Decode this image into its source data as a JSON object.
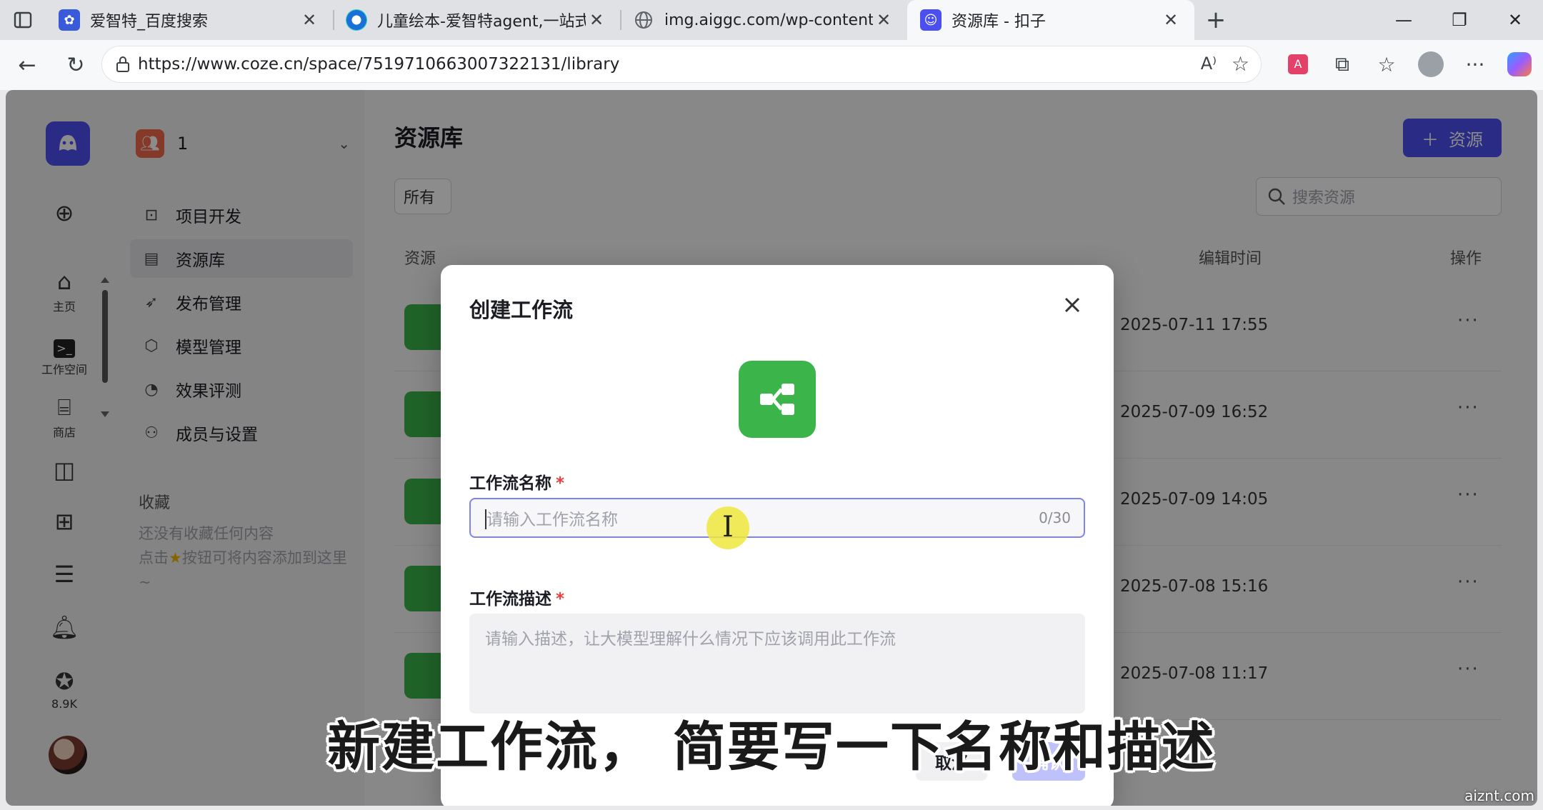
{
  "browser": {
    "tabs": [
      {
        "title": "爱智特_百度搜索",
        "icon": "baidu-paw-icon",
        "color": "#3a5bd9"
      },
      {
        "title": "儿童绘本-爱智特agent,一站式企业",
        "icon": "edge-swirl-icon",
        "color": "#1b6fd8"
      },
      {
        "title": "img.aiggc.com/wp-content/uploa",
        "icon": "globe-icon",
        "color": "#5f6368"
      },
      {
        "title": "资源库 - 扣子",
        "icon": "coze-icon",
        "color": "#4b4ff0"
      }
    ],
    "url": "https://www.coze.cn/space/7519710663007322131/library"
  },
  "rail": {
    "items": [
      {
        "label": "主页",
        "icon": "home-icon"
      },
      {
        "label": "工作空间",
        "icon": "terminal-icon"
      },
      {
        "label": "商店",
        "icon": "store-icon"
      },
      {
        "label": "",
        "icon": "layout-icon"
      },
      {
        "label": "",
        "icon": "apps-icon"
      },
      {
        "label": "",
        "icon": "doc-icon"
      },
      {
        "label": "",
        "icon": "bell-icon"
      },
      {
        "label": "8.9K",
        "icon": "star-badge-icon"
      }
    ]
  },
  "sidebar": {
    "team_name": "1",
    "menu": [
      {
        "label": "项目开发",
        "icon": "bot-icon"
      },
      {
        "label": "资源库",
        "icon": "library-icon",
        "active": true
      },
      {
        "label": "发布管理",
        "icon": "rocket-icon"
      },
      {
        "label": "模型管理",
        "icon": "cube-icon"
      },
      {
        "label": "效果评测",
        "icon": "gauge-icon"
      },
      {
        "label": "成员与设置",
        "icon": "members-icon"
      }
    ],
    "favorites_title": "收藏",
    "favorites_empty_1": "还没有收藏任何内容",
    "favorites_empty_2": "点击",
    "favorites_empty_3": "按钮可将内容添加到这里~"
  },
  "main": {
    "title": "资源库",
    "add_button": "资源",
    "filter_label": "所有",
    "search_placeholder": "搜索资源",
    "col_name": "资源",
    "col_edit_time": "编辑时间",
    "col_actions": "操作",
    "rows": [
      {
        "time": "2025-07-11 17:55"
      },
      {
        "time": "2025-07-09 16:52"
      },
      {
        "time": "2025-07-09 14:05"
      },
      {
        "time": "2025-07-08 15:16"
      },
      {
        "time": "2025-07-08 11:17"
      }
    ]
  },
  "modal": {
    "title": "创建工作流",
    "name_label": "工作流名称",
    "name_placeholder": "请输入工作流名称",
    "name_counter": "0/30",
    "desc_label": "工作流描述",
    "desc_placeholder": "请输入描述，让大模型理解什么情况下应该调用此工作流",
    "required_mark": "*",
    "cancel": "取消",
    "confirm": "确认"
  },
  "caption": "新建工作流， 简要写一下名称和描述",
  "watermark": "aiznt.com",
  "colors": {
    "accent": "#4b4ff0",
    "workflow_green": "#3bb54a",
    "required": "#f03b3b"
  }
}
